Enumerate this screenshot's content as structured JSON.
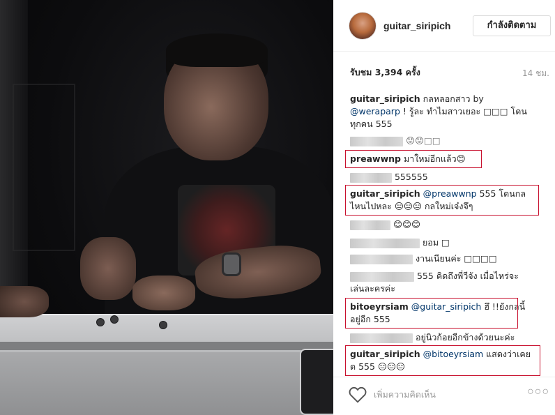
{
  "post": {
    "username": "guitar_siripich",
    "follow_label": "กำลังติดตาม",
    "views": "รับชม 3,394 ครั้ง",
    "time": "14 ชม."
  },
  "comments": [
    {
      "user": "guitar_siripich",
      "text": " กลหลอกสาว by"
    },
    {
      "mention": "@weraparp",
      "text": " ! รู้ละ ทำไมสาวเยอะ □□□ โดน"
    },
    {
      "text": "ทุกคน 555"
    },
    {
      "text": "😟😟□□"
    },
    {
      "user": "preawwnp",
      "text": " มาใหม่อีกแล้ว😊"
    },
    {
      "text": "555555"
    },
    {
      "user": "guitar_siripich",
      "mention": " @preawwnp",
      "text": " 555 โดนกล"
    },
    {
      "text": "ไหนไปหละ 😑😑😑 กลใหม่เจ๋งจึๆ"
    },
    {
      "text": "😊😊😊"
    },
    {
      "text": "ยอม □"
    },
    {
      "text": "งานเนียนค่ะ □□□□"
    },
    {
      "text": "555 คิดถึงพี่วีจัง เมื่อไหร่จะ"
    },
    {
      "text": "เล่นละครค่ะ"
    },
    {
      "user": "bitoeyrsiam",
      "mention": " @guitar_siripich",
      "text": " ฮึ !!ยังกลนี้"
    },
    {
      "text": "อยู่อีก 555"
    },
    {
      "text": "อยู่นิวก้อยอีกข้างด้วยนะค่ะ"
    },
    {
      "user": "guitar_siripich",
      "mention": " @bitoeyrsiam",
      "text": " แสดงว่าเคย"
    },
    {
      "text": "ด 555 😑😑😑"
    }
  ],
  "footer": {
    "add_comment_placeholder": "เพิ่มความคิดเห็น",
    "more_label": "○○○"
  },
  "icons": {
    "heart": "heart-icon",
    "more": "more-options-icon"
  },
  "colors": {
    "highlight_box": "#c8102e",
    "mention": "#003569",
    "muted": "#999999"
  }
}
